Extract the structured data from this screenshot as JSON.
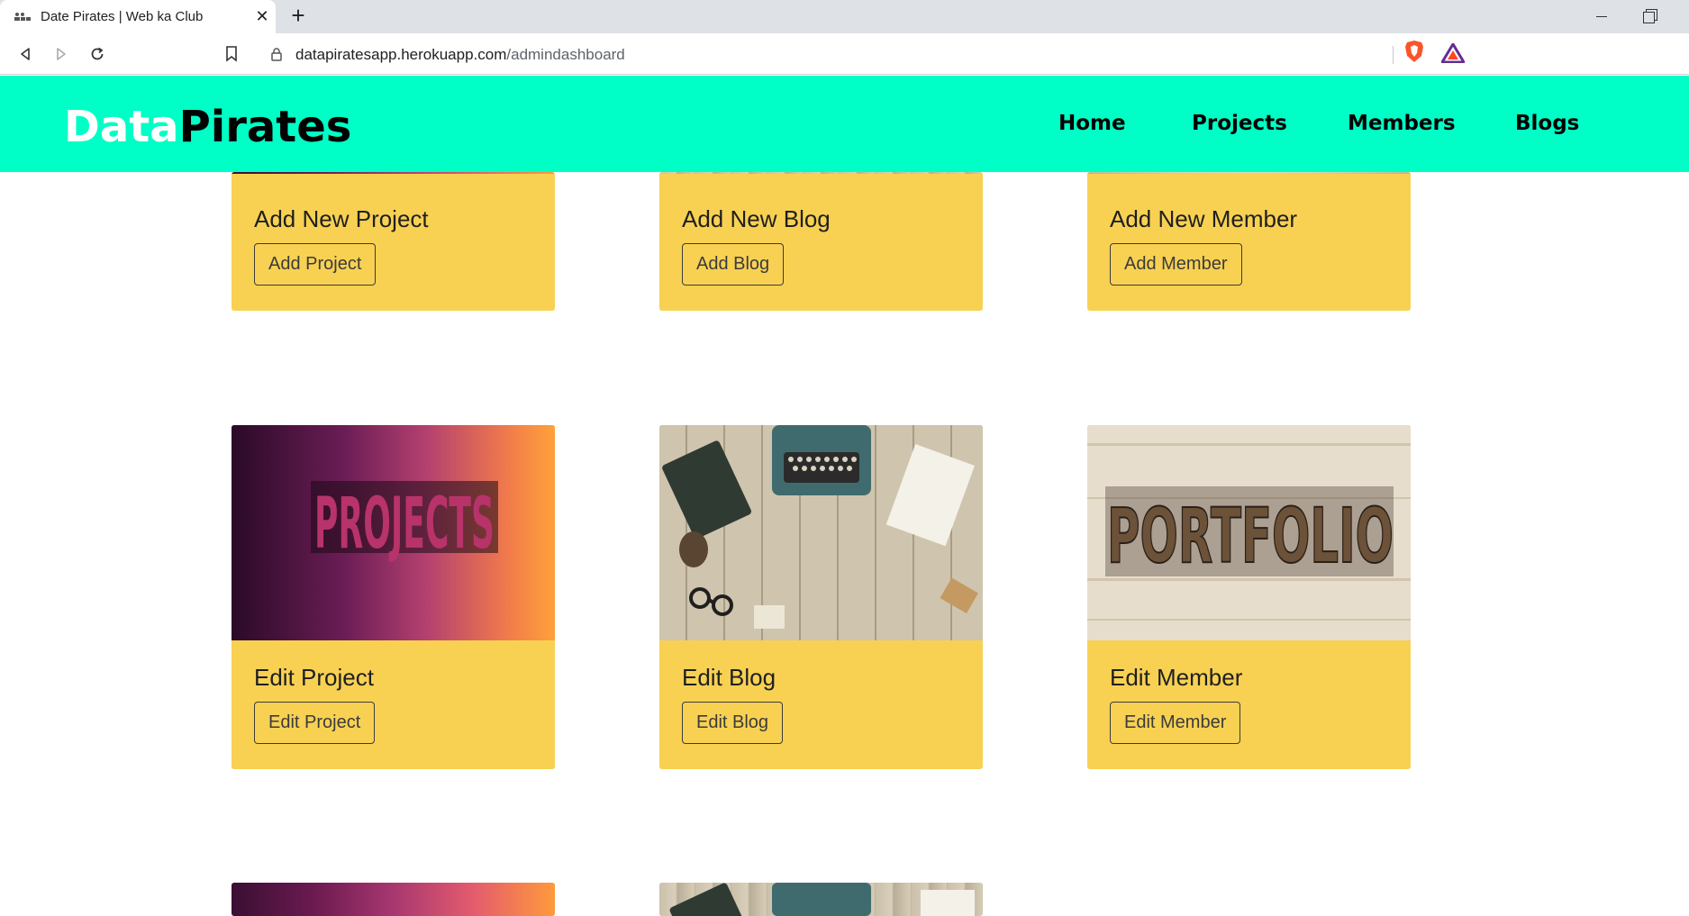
{
  "browser": {
    "tab_title": "Date Pirates | Web ka Club",
    "url_host": "datapiratesapp.herokuapp.com",
    "url_path": "/admindashboard"
  },
  "site": {
    "brand_part1": "Data",
    "brand_part2": "Pirates",
    "nav": [
      "Home",
      "Projects",
      "Members",
      "Blogs"
    ],
    "colors": {
      "header_bg": "#00ffc6",
      "card_bg": "#f8d153"
    }
  },
  "cards": {
    "add_project": {
      "title": "Add New Project",
      "button": "Add Project"
    },
    "add_blog": {
      "title": "Add New Blog",
      "button": "Add Blog"
    },
    "add_member": {
      "title": "Add New Member",
      "button": "Add Member"
    },
    "edit_project": {
      "title": "Edit Project",
      "button": "Edit Project",
      "image_text": "PROJECTS"
    },
    "edit_blog": {
      "title": "Edit Blog",
      "button": "Edit Blog"
    },
    "edit_member": {
      "title": "Edit Member",
      "button": "Edit Member",
      "image_text": "PORTFOLIO"
    }
  },
  "icons": [
    "back-icon",
    "forward-icon",
    "reload-icon",
    "bookmark-icon",
    "lock-icon",
    "brave-shield-icon",
    "brave-rewards-icon",
    "new-tab-icon",
    "close-icon",
    "minimize-icon",
    "restore-icon"
  ]
}
